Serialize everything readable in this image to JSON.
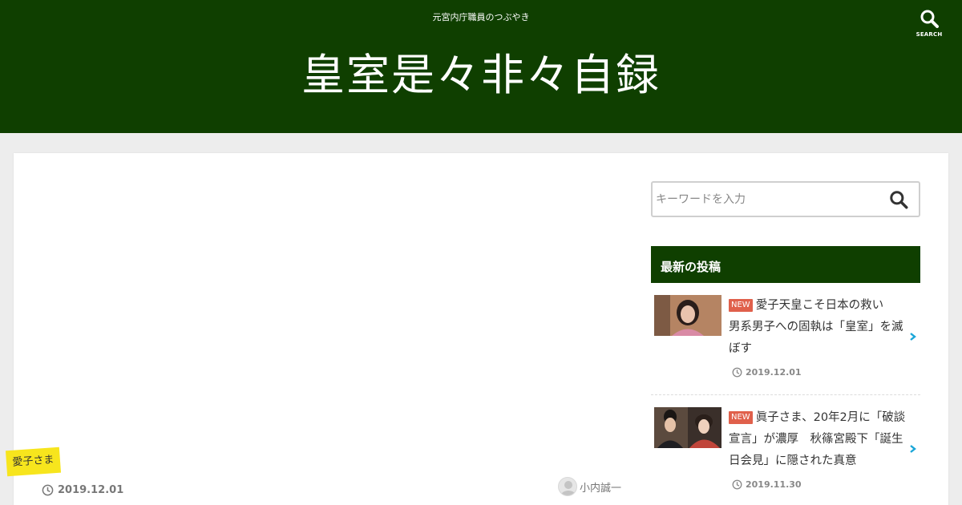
{
  "header": {
    "tagline": "元宮内庁職員のつぶやき",
    "site_title": "皇室是々非々自録",
    "search_label": "SEARCH",
    "background_color": "#0f3f00"
  },
  "article": {
    "category": "愛子さま",
    "date": "2019.12.01",
    "author": "小内誠一"
  },
  "sidebar": {
    "search": {
      "placeholder": "キーワードを入力",
      "value": ""
    },
    "recent_widget": {
      "title": "最新の投稿",
      "posts": [
        {
          "badge": "NEW",
          "title": "愛子天皇こそ日本の救い　男系男子への固執は「皇室」を滅ぼす",
          "date": "2019.12.01"
        },
        {
          "badge": "NEW",
          "title": "眞子さま、20年2月に「破談宣言」が濃厚　秋篠宮殿下「誕生日会見」に隠された真意",
          "date": "2019.11.30"
        }
      ]
    }
  },
  "colors": {
    "accent_green": "#0f3f00",
    "category_yellow": "#f7e51d",
    "new_badge_red": "#e0604b",
    "chevron_cyan": "#1aa6d8"
  }
}
